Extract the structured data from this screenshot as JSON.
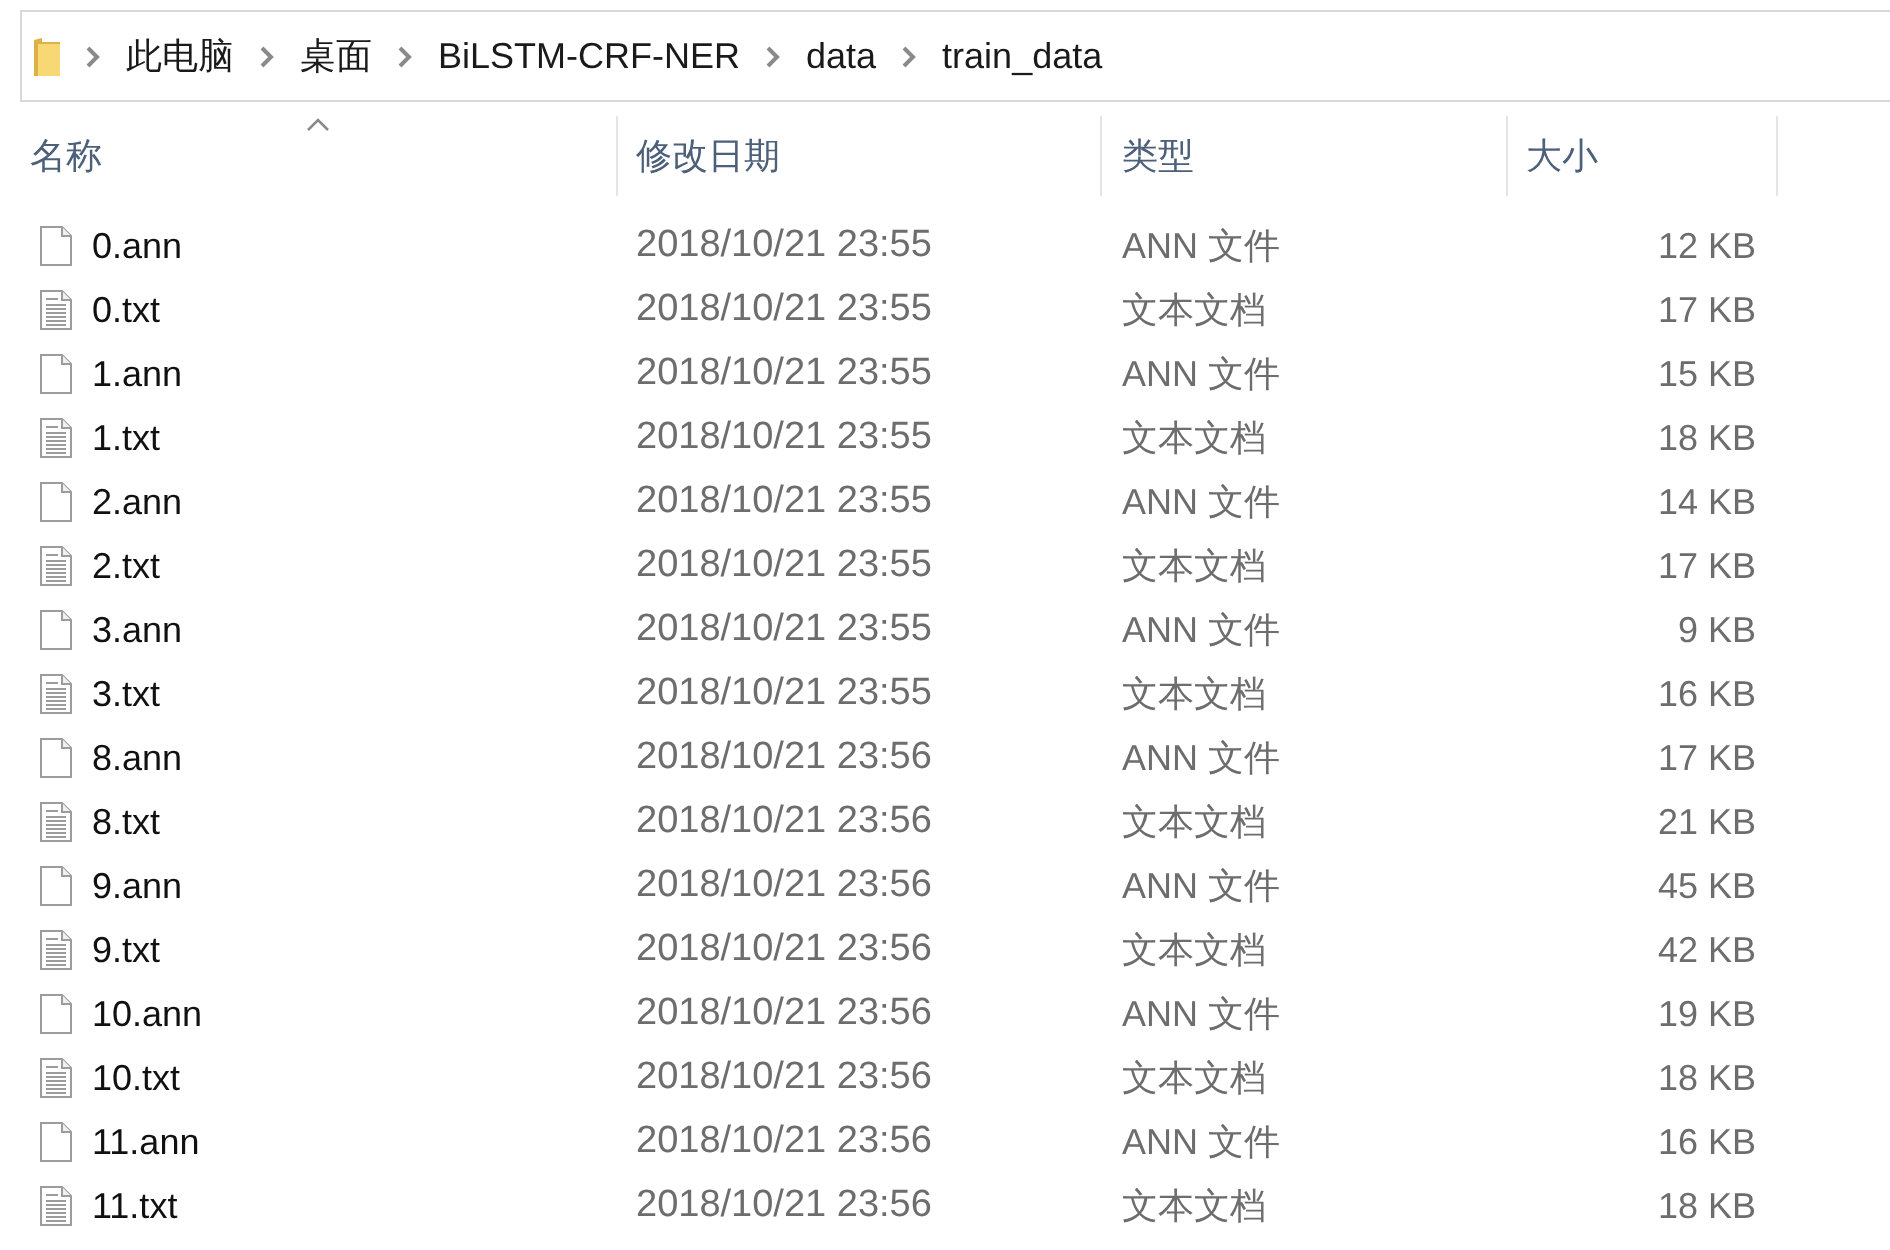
{
  "address_bar": {
    "path": [
      "此电脑",
      "桌面",
      "BiLSTM-CRF-NER",
      "data",
      "train_data"
    ]
  },
  "columns": [
    {
      "label": "名称",
      "sorted": true
    },
    {
      "label": "修改日期",
      "sorted": false
    },
    {
      "label": "类型",
      "sorted": false
    },
    {
      "label": "大小",
      "sorted": false
    }
  ],
  "files": [
    {
      "name": "0.ann",
      "kind": "ann",
      "modified": "2018/10/21 23:55",
      "type": "ANN 文件",
      "size": "12 KB"
    },
    {
      "name": "0.txt",
      "kind": "txt",
      "modified": "2018/10/21 23:55",
      "type": "文本文档",
      "size": "17 KB"
    },
    {
      "name": "1.ann",
      "kind": "ann",
      "modified": "2018/10/21 23:55",
      "type": "ANN 文件",
      "size": "15 KB"
    },
    {
      "name": "1.txt",
      "kind": "txt",
      "modified": "2018/10/21 23:55",
      "type": "文本文档",
      "size": "18 KB"
    },
    {
      "name": "2.ann",
      "kind": "ann",
      "modified": "2018/10/21 23:55",
      "type": "ANN 文件",
      "size": "14 KB"
    },
    {
      "name": "2.txt",
      "kind": "txt",
      "modified": "2018/10/21 23:55",
      "type": "文本文档",
      "size": "17 KB"
    },
    {
      "name": "3.ann",
      "kind": "ann",
      "modified": "2018/10/21 23:55",
      "type": "ANN 文件",
      "size": "9 KB"
    },
    {
      "name": "3.txt",
      "kind": "txt",
      "modified": "2018/10/21 23:55",
      "type": "文本文档",
      "size": "16 KB"
    },
    {
      "name": "8.ann",
      "kind": "ann",
      "modified": "2018/10/21 23:56",
      "type": "ANN 文件",
      "size": "17 KB"
    },
    {
      "name": "8.txt",
      "kind": "txt",
      "modified": "2018/10/21 23:56",
      "type": "文本文档",
      "size": "21 KB"
    },
    {
      "name": "9.ann",
      "kind": "ann",
      "modified": "2018/10/21 23:56",
      "type": "ANN 文件",
      "size": "45 KB"
    },
    {
      "name": "9.txt",
      "kind": "txt",
      "modified": "2018/10/21 23:56",
      "type": "文本文档",
      "size": "42 KB"
    },
    {
      "name": "10.ann",
      "kind": "ann",
      "modified": "2018/10/21 23:56",
      "type": "ANN 文件",
      "size": "19 KB"
    },
    {
      "name": "10.txt",
      "kind": "txt",
      "modified": "2018/10/21 23:56",
      "type": "文本文档",
      "size": "18 KB"
    },
    {
      "name": "11.ann",
      "kind": "ann",
      "modified": "2018/10/21 23:56",
      "type": "ANN 文件",
      "size": "16 KB"
    },
    {
      "name": "11.txt",
      "kind": "txt",
      "modified": "2018/10/21 23:56",
      "type": "文本文档",
      "size": "18 KB"
    }
  ]
}
